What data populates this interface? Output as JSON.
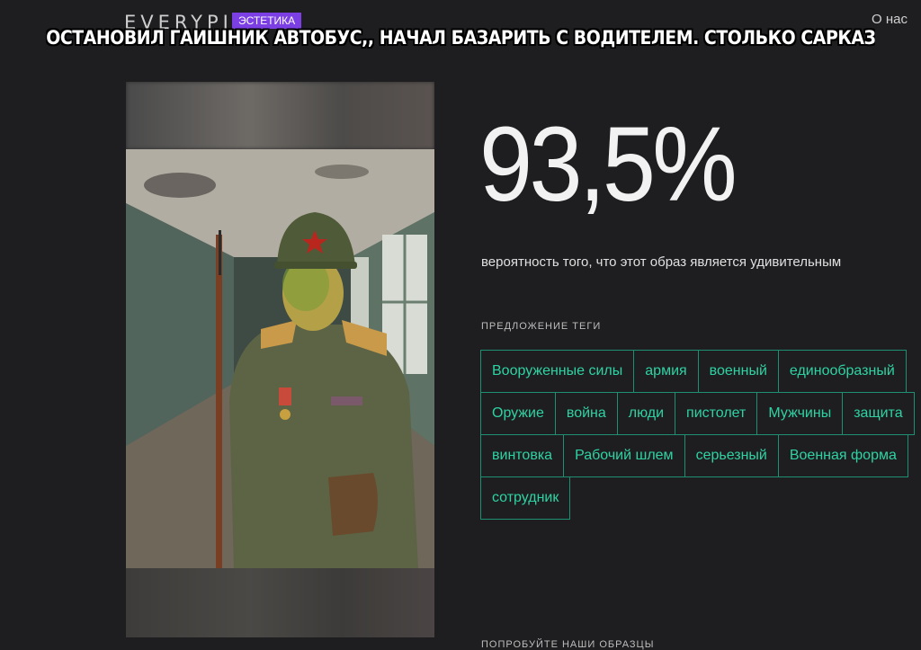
{
  "header": {
    "logo": "EVERYPIXEL",
    "logo_tag": "ЭСТЕТИКА",
    "about_link": "О нас"
  },
  "meme_caption": "ОСТАНОВИЛ ГАИШНИК АВТОБУС,, НАЧАЛ БАЗАРИТЬ С ВОДИТЕЛЕМ. СТОЛЬКО САРКАЗМА В РАЗГОВОРЕ Я ЕЩЁ НЕ СЛЫША...",
  "result": {
    "probability": "93,5%",
    "caption": "вероятность того, что этот образ является удивительным"
  },
  "tags": {
    "heading": "ПРЕДЛОЖЕНИЕ ТЕГИ",
    "rows": [
      [
        "Вооруженные силы",
        "армия",
        "военный",
        "единообразный"
      ],
      [
        "Оружие",
        "война",
        "люди",
        "пистолет",
        "Мужчины",
        "защита"
      ],
      [
        "винтовка",
        "Рабочий шлем",
        "серьезный",
        "Военная форма"
      ],
      [
        "сотрудник"
      ]
    ]
  },
  "footer": {
    "try_heading": "ПОПРОБУЙТЕ НАШИ ОБРАЗЦЫ"
  },
  "colors": {
    "background": "#1e1e20",
    "tag_border": "#1f8f74",
    "tag_text": "#2ed3a3",
    "logo_tag_bg": "#7b3fe4"
  }
}
